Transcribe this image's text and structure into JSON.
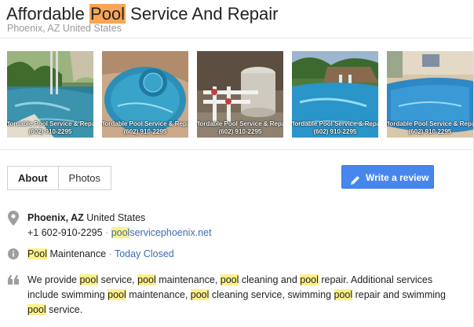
{
  "business": {
    "name_pre": "Affordable ",
    "name_hl": "Pool",
    "name_post": " Service And Repair",
    "location": "Phoenix, AZ United States"
  },
  "photos": [
    {
      "watermark_line1": "Affordable Pool Service & Repair",
      "watermark_line2": "(602) 910-2295"
    },
    {
      "watermark_line1": "Affordable Pool Service & Repair",
      "watermark_line2": "(602) 910-2295"
    },
    {
      "watermark_line1": "Affordable Pool Service & Repair",
      "watermark_line2": "(602) 910-2295"
    },
    {
      "watermark_line1": "Affordable Pool Service & Repair",
      "watermark_line2": "(602) 910-2295"
    },
    {
      "watermark_line1": "Affordable Pool Service & Repair",
      "watermark_line2": "(602) 910-2295"
    }
  ],
  "tabs": [
    {
      "label": "About",
      "active": true
    },
    {
      "label": "Photos",
      "active": false
    }
  ],
  "review_button": {
    "label": "Write a review"
  },
  "address": {
    "city": "Phoenix, AZ",
    "country": " United States",
    "phone": "+1 602-910-2295",
    "separator": " · ",
    "website_hl": "pool",
    "website_rest": "servicephoenix.net"
  },
  "category": {
    "hl": "Pool",
    "rest": " Maintenance",
    "separator": " · ",
    "hours": "Today Closed"
  },
  "description": {
    "parts": [
      [
        "We provide ",
        false
      ],
      [
        "pool",
        true
      ],
      [
        " service, ",
        false
      ],
      [
        "pool",
        true
      ],
      [
        " maintenance, ",
        false
      ],
      [
        "pool",
        true
      ],
      [
        " cleaning and ",
        false
      ],
      [
        "pool",
        true
      ],
      [
        " repair. Additional services include swimming ",
        false
      ],
      [
        "pool",
        true
      ],
      [
        " maintenance, ",
        false
      ],
      [
        "pool",
        true
      ],
      [
        " cleaning service, swimming ",
        false
      ],
      [
        "pool",
        true
      ],
      [
        " repair and swimming ",
        false
      ],
      [
        "pool",
        true
      ],
      [
        " service.",
        false
      ]
    ]
  },
  "colors": {
    "highlight_strong": "#f8a656",
    "highlight": "#fdf088",
    "link": "#1a0dab",
    "button": "#4787ed"
  },
  "icons": {
    "address": "map-pin-icon",
    "info": "info-icon",
    "quote": "quote-icon",
    "review": "pencil-icon"
  }
}
